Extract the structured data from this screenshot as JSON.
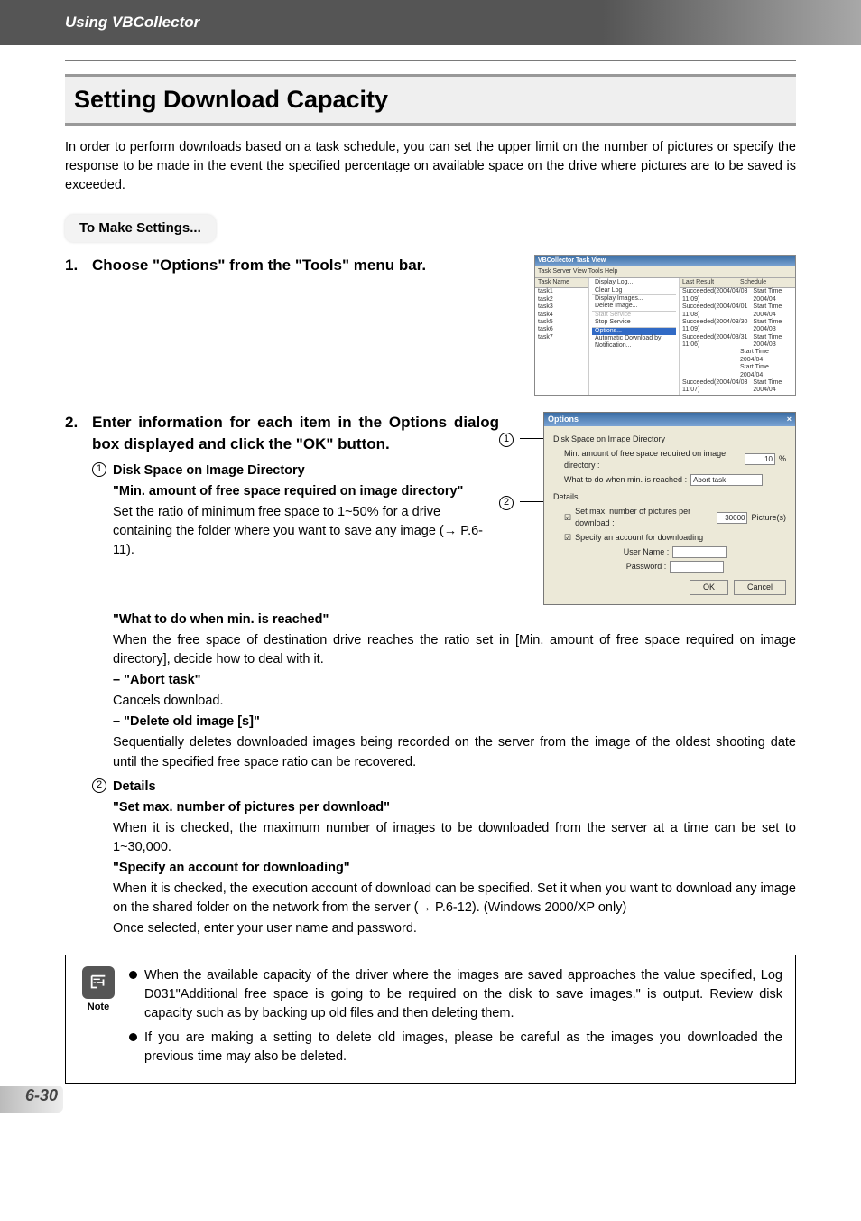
{
  "header": {
    "breadcrumb": "Using VBCollector"
  },
  "section": {
    "title": "Setting Download Capacity"
  },
  "intro": "In order to perform downloads based on a task schedule, you can set the upper limit on the number of pictures or specify the response to be made in the event the specified percentage on available space on the drive where pictures are to be saved is exceeded.",
  "subhead": "To Make Settings...",
  "step1": {
    "num": "1.",
    "headline": "Choose \"Options\" from the \"Tools\" menu bar.",
    "window": {
      "title": "VBCollector Task View",
      "menu": "Task  Server  View  Tools  Help",
      "col_a_head": "Task Name",
      "tasks": [
        "task1",
        "task2",
        "task3",
        "task4",
        "task5",
        "task6",
        "task7"
      ],
      "tools_items": [
        "Display Log...",
        "Clear Log",
        "Display Images...",
        "Delete Image...",
        "Start Service",
        "Stop Service",
        "Options...",
        "Automatic Download by Notification..."
      ],
      "col_c_head_result": "Last Result",
      "col_c_head_sched": "Schedule",
      "rows": [
        {
          "r": "Succeeded(2004/04/03 11:09)",
          "s": "Start Time 2004/04"
        },
        {
          "r": "Succeeded(2004/04/01 11:08)",
          "s": "Start Time 2004/04"
        },
        {
          "r": "Succeeded(2004/03/30 11:09)",
          "s": "Start Time 2004/03"
        },
        {
          "r": "Succeeded(2004/03/31 11:06)",
          "s": "Start Time 2004/03"
        },
        {
          "r": "",
          "s": "Start Time 2004/04"
        },
        {
          "r": "",
          "s": "Start Time 2004/04"
        },
        {
          "r": "Succeeded(2004/04/03 11:07)",
          "s": "Start Time 2004/04"
        }
      ]
    }
  },
  "step2": {
    "num": "2.",
    "headline": "Enter information for each item in the Options dialog box displayed and click the \"OK\" button.",
    "item1": {
      "label": "Disk Space on Image Directory",
      "q1": "\"Min. amount of free space required on image directory\"",
      "p1a": "Set the ratio of minimum free space to 1~50% for a drive containing the folder where you want to save any image (→ P.6-11).",
      "q2": "\"What to do when min. is reached\"",
      "p2": "When the free space of destination drive reaches the ratio set in [Min. amount of free space required on image directory], decide how to deal with it.",
      "opt1_label": "– \"Abort task\"",
      "opt1_text": "Cancels download.",
      "opt2_label": "– \"Delete old image [s]\"",
      "opt2_text": "Sequentially deletes downloaded images being recorded on the server from the image of the oldest shooting date until the specified free space ratio can be recovered."
    },
    "item2": {
      "label": "Details",
      "q1": "\"Set max. number of pictures per download\"",
      "p1": "When it is checked, the maximum number of images to be downloaded from the server at a time can be set to 1~30,000.",
      "q2": "\"Specify an account for downloading\"",
      "p2": "When it is checked, the execution account of download can be specified. Set it when you want to download any image on the shared folder on the network from the server (→ P.6-12). (Windows 2000/XP only)",
      "p3": "Once selected, enter your user name and password."
    },
    "dialog": {
      "title": "Options",
      "grp1": "Disk Space on Image Directory",
      "row1_label": "Min. amount of free space required on image directory :",
      "row1_val": "10",
      "row1_unit": "%",
      "row2_label": "What to do when min. is reached :",
      "row2_val": "Abort task",
      "grp2": "Details",
      "row3_label": "Set max. number of pictures per download :",
      "row3_val": "30000",
      "row3_unit": "Picture(s)",
      "row4_label": "Specify an account for downloading",
      "row5_label": "User Name :",
      "row6_label": "Password :",
      "ok": "OK",
      "cancel": "Cancel"
    }
  },
  "note": {
    "label": "Note",
    "n1": "When the available capacity of the driver where the images are saved approaches the value specified, Log D031\"Additional free space is going to be required on the disk to save images.\" is output. Review disk capacity such as by backing up old files and then deleting them.",
    "n2": "If you are making a setting to delete old images, please be careful as the images you downloaded the previous time may also be deleted."
  },
  "page_number": "6-30",
  "circled": {
    "one": "1",
    "two": "2"
  }
}
